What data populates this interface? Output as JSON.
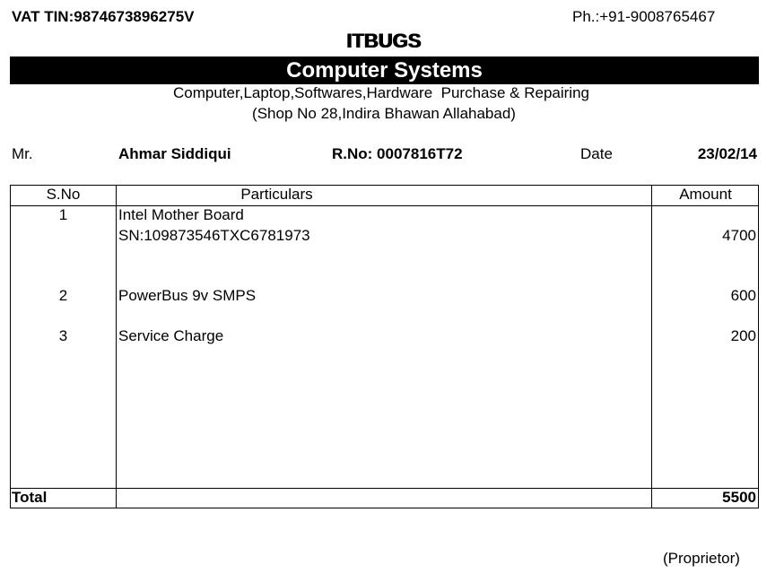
{
  "header": {
    "vat_tin": "VAT TIN:9874673896275V",
    "phone": "Ph.:+91-9008765467",
    "brand": "ITBUGS",
    "banner": "Computer Systems",
    "services": "Computer,Laptop,Softwares,Hardware  Purchase & Repairing",
    "address": "(Shop No 28,Indira Bhawan Allahabad)"
  },
  "customer": {
    "salutation": "Mr.",
    "name": "Ahmar Siddiqui",
    "receipt_no": "R.No: 0007816T72",
    "date_label": "Date",
    "date": "23/02/14"
  },
  "table": {
    "columns": [
      "S.No",
      "Particulars",
      "Amount"
    ],
    "rows": [
      {
        "sno": "1",
        "particulars": "Intel Mother Board",
        "particulars_line2": "SN:109873546TXC6781973",
        "amount": "4700"
      },
      {
        "sno": "2",
        "particulars": "PowerBus 9v SMPS",
        "amount": "600"
      },
      {
        "sno": "3",
        "particulars": "Service Charge",
        "amount": "200"
      }
    ],
    "total_label": "Total",
    "total": "5500"
  },
  "footer": {
    "signature": "(Proprietor)"
  }
}
